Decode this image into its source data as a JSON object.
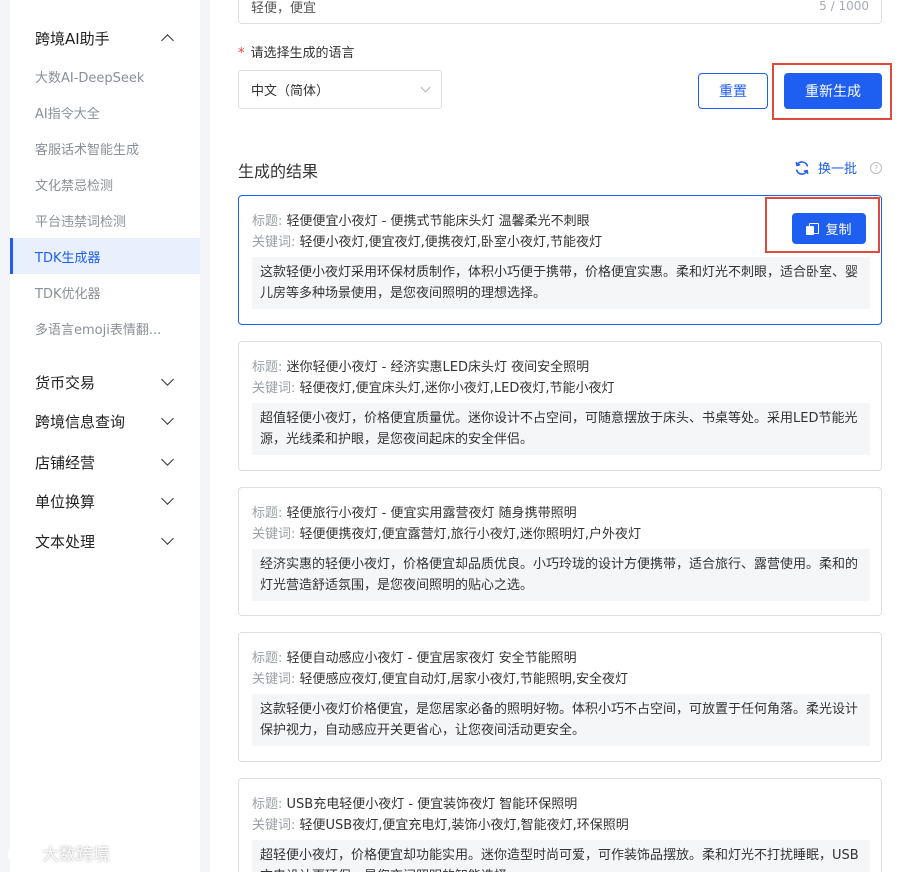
{
  "sidebar": {
    "expanded_group": "跨境AI助手",
    "items": [
      {
        "label": "大数AI-DeepSeek"
      },
      {
        "label": "AI指令大全"
      },
      {
        "label": "客服话术智能生成"
      },
      {
        "label": "文化禁忌检测"
      },
      {
        "label": "平台违禁词检测"
      },
      {
        "label": "TDK生成器",
        "active": true
      },
      {
        "label": "TDK优化器"
      },
      {
        "label": "多语言emoji表情翻..."
      }
    ],
    "groups": [
      {
        "label": "货币交易"
      },
      {
        "label": "跨境信息查询"
      },
      {
        "label": "店铺经营"
      },
      {
        "label": "单位换算"
      },
      {
        "label": "文本处理"
      }
    ]
  },
  "form": {
    "prev_input_value": "轻便，便宜",
    "prev_input_counter": "5 / 1000",
    "required_mark": "*",
    "language_label": "请选择生成的语言",
    "language_value": "中文（简体）",
    "reset_label": "重置",
    "regenerate_label": "重新生成"
  },
  "results": {
    "title": "生成的结果",
    "refresh_label": "换一批",
    "help_glyph": "?",
    "copy_label": "复制",
    "title_key": "标题:",
    "keywords_key": "关键词:",
    "cards": [
      {
        "title": "轻便便宜小夜灯 - 便携式节能床头灯 温馨柔光不刺眼",
        "keywords": "轻便小夜灯,便宜夜灯,便携夜灯,卧室小夜灯,节能夜灯",
        "desc": "这款轻便小夜灯采用环保材质制作，体积小巧便于携带，价格便宜实惠。柔和灯光不刺眼，适合卧室、婴儿房等多种场景使用，是您夜间照明的理想选择。"
      },
      {
        "title": "迷你轻便小夜灯 - 经济实惠LED床头灯 夜间安全照明",
        "keywords": "轻便夜灯,便宜床头灯,迷你小夜灯,LED夜灯,节能小夜灯",
        "desc": "超值轻便小夜灯，价格便宜质量优。迷你设计不占空间，可随意摆放于床头、书桌等处。采用LED节能光源，光线柔和护眼，是您夜间起床的安全伴侣。"
      },
      {
        "title": "轻便旅行小夜灯 - 便宜实用露营夜灯 随身携带照明",
        "keywords": "轻便便携夜灯,便宜露营灯,旅行小夜灯,迷你照明灯,户外夜灯",
        "desc": "经济实惠的轻便小夜灯，价格便宜却品质优良。小巧玲珑的设计方便携带，适合旅行、露营使用。柔和的灯光营造舒适氛围，是您夜间照明的贴心之选。"
      },
      {
        "title": "轻便自动感应小夜灯 - 便宜居家夜灯 安全节能照明",
        "keywords": "轻便感应夜灯,便宜自动灯,居家小夜灯,节能照明,安全夜灯",
        "desc": "这款轻便小夜灯价格便宜，是您居家必备的照明好物。体积小巧不占空间，可放置于任何角落。柔光设计保护视力，自动感应开关更省心，让您夜间活动更安全。"
      },
      {
        "title": "USB充电轻便小夜灯 - 便宜装饰夜灯 智能环保照明",
        "keywords": "轻便USB夜灯,便宜充电灯,装饰小夜灯,智能夜灯,环保照明",
        "desc": "超轻便小夜灯，价格便宜却功能实用。迷你造型时尚可爱，可作装饰品摆放。柔和灯光不打扰睡眠，USB充电设计更环保，是您夜间照明的智能选择。"
      }
    ]
  },
  "watermark": {
    "text": "大数跨境"
  }
}
